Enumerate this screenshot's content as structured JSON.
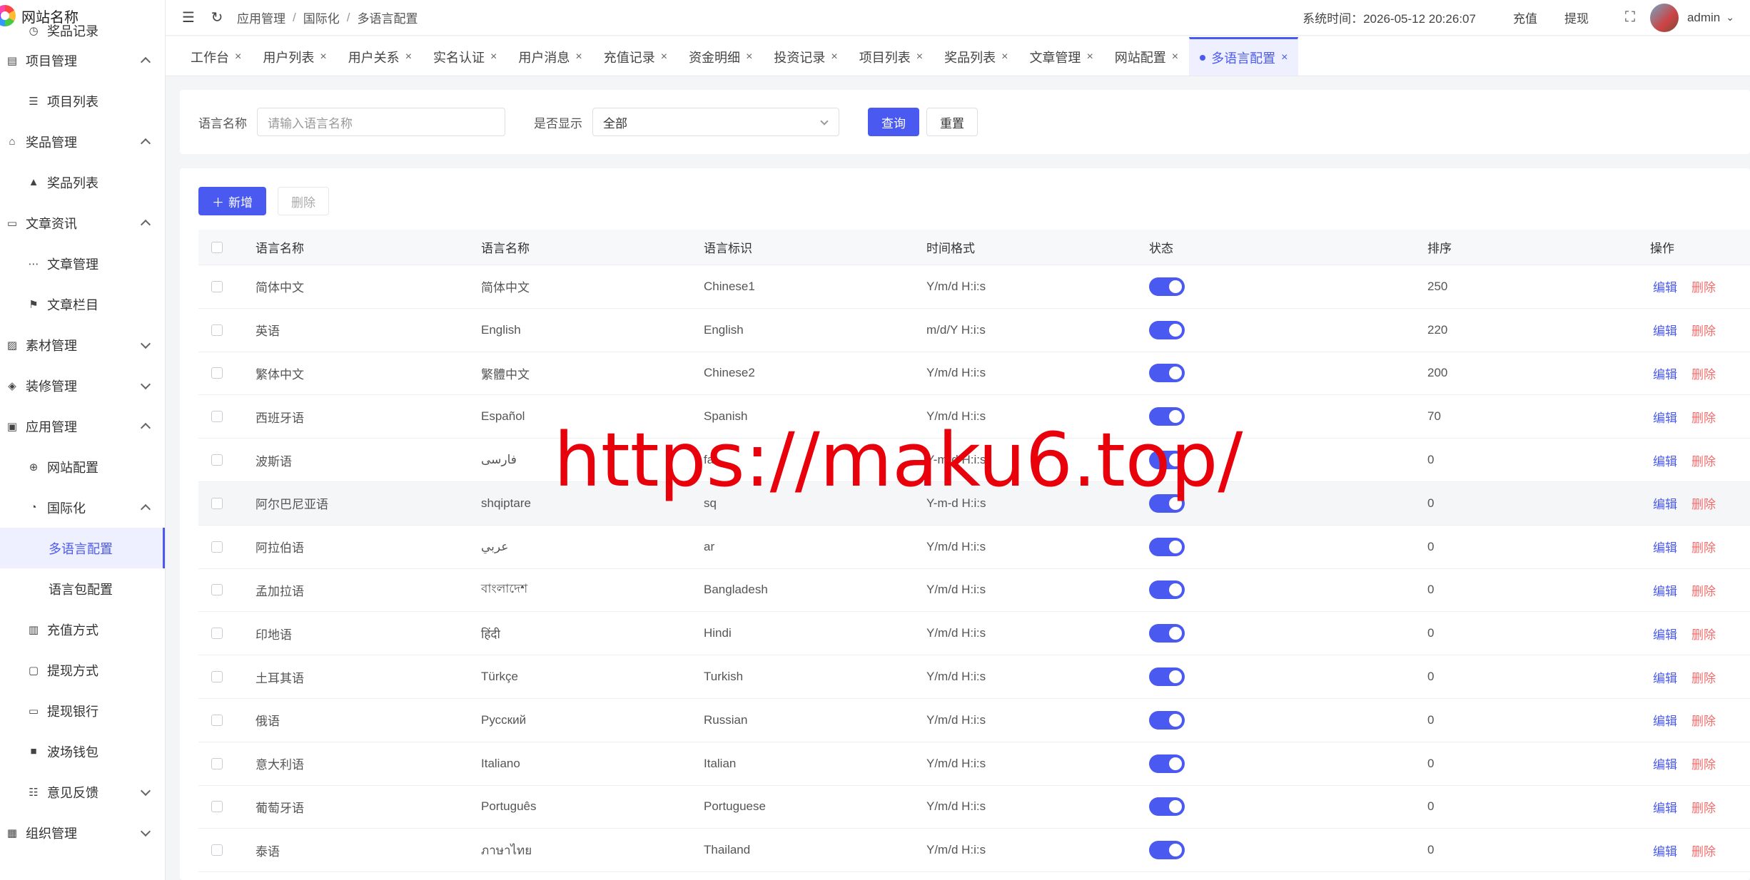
{
  "app": {
    "site_name": "网站名称"
  },
  "sidebar": {
    "items": [
      {
        "label": "奖品记录",
        "icon": "clock-icon",
        "level": "sub"
      },
      {
        "label": "项目管理",
        "icon": "document-icon",
        "level": "group",
        "expanded": true
      },
      {
        "label": "项目列表",
        "icon": "list-icon",
        "level": "sub"
      },
      {
        "label": "奖品管理",
        "icon": "bag-icon",
        "level": "group",
        "expanded": true
      },
      {
        "label": "奖品列表",
        "icon": "bag-filled-icon",
        "level": "sub"
      },
      {
        "label": "文章资讯",
        "icon": "message-icon",
        "level": "group",
        "expanded": true
      },
      {
        "label": "文章管理",
        "icon": "chat-icon",
        "level": "sub"
      },
      {
        "label": "文章栏目",
        "icon": "bookmark-icon",
        "level": "sub"
      },
      {
        "label": "素材管理",
        "icon": "image-icon",
        "level": "group",
        "expanded": false
      },
      {
        "label": "装修管理",
        "icon": "palette-icon",
        "level": "group",
        "expanded": false
      },
      {
        "label": "应用管理",
        "icon": "app-icon",
        "level": "group",
        "expanded": true
      },
      {
        "label": "网站配置",
        "icon": "globe-icon",
        "level": "sub"
      },
      {
        "label": "国际化",
        "icon": "compass-icon",
        "level": "sub",
        "expanded": true
      },
      {
        "label": "多语言配置",
        "icon": "",
        "level": "deep",
        "active": true
      },
      {
        "label": "语言包配置",
        "icon": "",
        "level": "deep"
      },
      {
        "label": "充值方式",
        "icon": "wallet-icon",
        "level": "sub"
      },
      {
        "label": "提现方式",
        "icon": "folder-icon",
        "level": "sub"
      },
      {
        "label": "提现银行",
        "icon": "card-icon",
        "level": "sub"
      },
      {
        "label": "波场钱包",
        "icon": "wallet-filled-icon",
        "level": "sub"
      },
      {
        "label": "意见反馈",
        "icon": "feedback-icon",
        "level": "sub",
        "expanded": false
      },
      {
        "label": "组织管理",
        "icon": "building-icon",
        "level": "group",
        "expanded": false
      }
    ]
  },
  "header": {
    "breadcrumb": [
      "应用管理",
      "国际化",
      "多语言配置"
    ],
    "system_time_label": "系统时间：",
    "system_time": "2026-05-12 20:26:07",
    "recharge": "充值",
    "withdraw": "提现",
    "username": "admin"
  },
  "tabs": [
    "工作台",
    "用户列表",
    "用户关系",
    "实名认证",
    "用户消息",
    "充值记录",
    "资金明细",
    "投资记录",
    "项目列表",
    "奖品列表",
    "文章管理",
    "网站配置",
    "多语言配置"
  ],
  "active_tab": "多语言配置",
  "search": {
    "name_label": "语言名称",
    "name_placeholder": "请输入语言名称",
    "show_label": "是否显示",
    "show_value": "全部",
    "query_button": "查询",
    "reset_button": "重置"
  },
  "toolbar": {
    "add_button": "新增",
    "delete_button": "删除"
  },
  "table": {
    "headers": [
      "语言名称",
      "语言名称",
      "语言标识",
      "时间格式",
      "状态",
      "排序",
      "操作"
    ],
    "edit_label": "编辑",
    "delete_label": "删除",
    "rows": [
      {
        "name": "简体中文",
        "native": "简体中文",
        "code": "Chinese1",
        "format": "Y/m/d H:i:s",
        "status": true,
        "sort": "250"
      },
      {
        "name": "英语",
        "native": "English",
        "code": "English",
        "format": "m/d/Y H:i:s",
        "status": true,
        "sort": "220"
      },
      {
        "name": "繁体中文",
        "native": "繁體中文",
        "code": "Chinese2",
        "format": "Y/m/d H:i:s",
        "status": true,
        "sort": "200"
      },
      {
        "name": "西班牙语",
        "native": "Español",
        "code": "Spanish",
        "format": "Y/m/d H:i:s",
        "status": true,
        "sort": "70"
      },
      {
        "name": "波斯语",
        "native": "فارسی",
        "code": "fa",
        "format": "Y-m-d H:i:s",
        "status": true,
        "sort": "0"
      },
      {
        "name": "阿尔巴尼亚语",
        "native": "shqiptare",
        "code": "sq",
        "format": "Y-m-d H:i:s",
        "status": true,
        "sort": "0"
      },
      {
        "name": "阿拉伯语",
        "native": "عربي",
        "code": "ar",
        "format": "Y/m/d H:i:s",
        "status": true,
        "sort": "0"
      },
      {
        "name": "孟加拉语",
        "native": "বাংলাদেশ",
        "code": "Bangladesh",
        "format": "Y/m/d H:i:s",
        "status": true,
        "sort": "0"
      },
      {
        "name": "印地语",
        "native": "हिंदी",
        "code": "Hindi",
        "format": "Y/m/d H:i:s",
        "status": true,
        "sort": "0"
      },
      {
        "name": "土耳其语",
        "native": "Türkçe",
        "code": "Turkish",
        "format": "Y/m/d H:i:s",
        "status": true,
        "sort": "0"
      },
      {
        "name": "俄语",
        "native": "Русский",
        "code": "Russian",
        "format": "Y/m/d H:i:s",
        "status": true,
        "sort": "0"
      },
      {
        "name": "意大利语",
        "native": "Italiano",
        "code": "Italian",
        "format": "Y/m/d H:i:s",
        "status": true,
        "sort": "0"
      },
      {
        "name": "葡萄牙语",
        "native": "Português",
        "code": "Portuguese",
        "format": "Y/m/d H:i:s",
        "status": true,
        "sort": "0"
      },
      {
        "name": "泰语",
        "native": "ภาษาไทย",
        "code": "Thailand",
        "format": "Y/m/d H:i:s",
        "status": true,
        "sort": "0"
      }
    ]
  },
  "watermark": "https://maku6.top/",
  "colors": {
    "accent": "#4a5af0",
    "danger": "#f56c6c",
    "watermark": "#e8000b"
  }
}
